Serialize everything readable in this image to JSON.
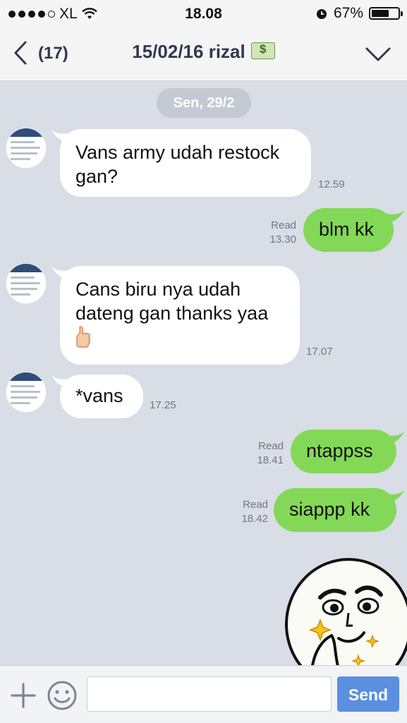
{
  "status_bar": {
    "carrier": "XL",
    "time": "18.08",
    "battery": "67%",
    "battery_level": 0.67
  },
  "header": {
    "unread_count": "(17)",
    "title": "15/02/16 rizal",
    "title_icon": "money-bill-emoji"
  },
  "chat": {
    "date_separator": "Sen, 29/2",
    "messages": [
      {
        "direction": "in",
        "text": "Vans army udah restock gan?",
        "time": "12.59"
      },
      {
        "direction": "out",
        "text": "blm kk",
        "read": "Read",
        "time": "13.30"
      },
      {
        "direction": "in",
        "text": "Cans biru nya udah dateng gan thanks yaa",
        "emoji": "thumbs-up",
        "time": "17.07"
      },
      {
        "direction": "in",
        "text": "*vans",
        "time": "17.25"
      },
      {
        "direction": "out",
        "text": "ntappss",
        "read": "Read",
        "time": "18.41"
      },
      {
        "direction": "out",
        "text": "siappp kk",
        "read": "Read",
        "time": "18.42"
      }
    ],
    "sticker": "smirking-face-sticker"
  },
  "input_bar": {
    "message_value": "",
    "send_label": "Send"
  },
  "colors": {
    "chat_background": "#d8dde6",
    "outgoing_bubble": "#83d857",
    "incoming_bubble": "#ffffff",
    "send_button": "#5b8fe0"
  }
}
